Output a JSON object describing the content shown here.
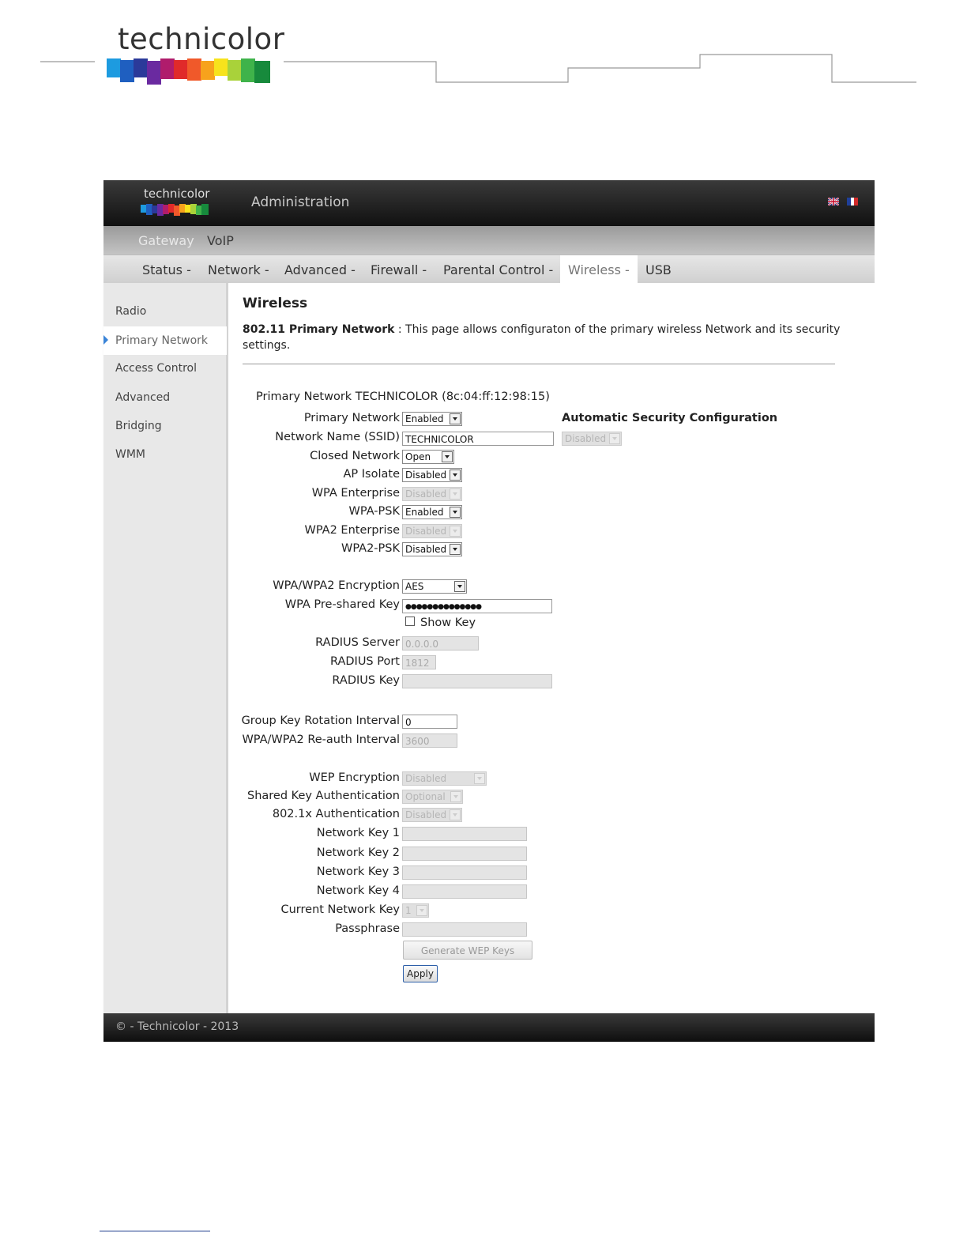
{
  "doc": {
    "logo_text": "technicolor"
  },
  "app": {
    "logo_text": "technicolor",
    "title": "Administration",
    "languages": [
      "english-flag-icon",
      "french-flag-icon"
    ]
  },
  "nav_primary": [
    "Gateway",
    "VoIP"
  ],
  "nav_secondary": {
    "status": "Status -",
    "network": "Network -",
    "advanced": "Advanced -",
    "firewall": "Firewall -",
    "parental": "Parental Control -",
    "wireless": "Wireless -",
    "usb": "USB",
    "active": "Wireless -"
  },
  "sidebar": {
    "items": [
      "Radio",
      "Primary Network",
      "Access Control",
      "Advanced",
      "Bridging",
      "WMM"
    ],
    "active": "Primary Network"
  },
  "page": {
    "title": "Wireless",
    "desc_bold": "802.11 Primary Network",
    "desc_text": " :  This page allows configuraton of the primary wireless Network and its security settings.",
    "network_header": "Primary Network TECHNICOLOR (8c:04:ff:12:98:15)"
  },
  "form": {
    "primary_network": {
      "label": "Primary Network",
      "value": "Enabled"
    },
    "ssid": {
      "label": "Network Name (SSID)",
      "value": "TECHNICOLOR"
    },
    "closed_network": {
      "label": "Closed Network",
      "value": "Open"
    },
    "ap_isolate": {
      "label": "AP Isolate",
      "value": "Disabled"
    },
    "wpa_enterprise": {
      "label": "WPA Enterprise",
      "value": "Disabled"
    },
    "wpa_psk": {
      "label": "WPA-PSK",
      "value": "Enabled"
    },
    "wpa2_enterprise": {
      "label": "WPA2 Enterprise",
      "value": "Disabled"
    },
    "wpa2_psk": {
      "label": "WPA2-PSK",
      "value": "Disabled"
    },
    "encryption": {
      "label": "WPA/WPA2 Encryption",
      "value": "AES"
    },
    "psk": {
      "label": "WPA Pre-shared Key",
      "value": "●●●●●●●●●●●●●●"
    },
    "show_key": "Show Key",
    "radius_server": {
      "label": "RADIUS Server",
      "value": "0.0.0.0"
    },
    "radius_port": {
      "label": "RADIUS Port",
      "value": "1812"
    },
    "radius_key": {
      "label": "RADIUS Key",
      "value": ""
    },
    "group_key": {
      "label": "Group Key Rotation Interval",
      "value": "0"
    },
    "reauth": {
      "label": "WPA/WPA2 Re-auth Interval",
      "value": "3600"
    },
    "wep_encryption": {
      "label": "WEP Encryption",
      "value": "Disabled"
    },
    "shared_key_auth": {
      "label": "Shared Key Authentication",
      "value": "Optional"
    },
    "auth_8021x": {
      "label": "802.1x Authentication",
      "value": "Disabled"
    },
    "key1": {
      "label": "Network Key 1",
      "value": ""
    },
    "key2": {
      "label": "Network Key 2",
      "value": ""
    },
    "key3": {
      "label": "Network Key 3",
      "value": ""
    },
    "key4": {
      "label": "Network Key 4",
      "value": ""
    },
    "current_key": {
      "label": "Current Network Key",
      "value": "1"
    },
    "passphrase": {
      "label": "Passphrase",
      "value": ""
    },
    "generate_button": "Generate WEP Keys",
    "apply_button": "Apply"
  },
  "auto_security": {
    "title": "Automatic Security Configuration",
    "value": "Disabled"
  },
  "footer": {
    "text": "© - Technicolor - 2013"
  },
  "colors": {
    "accent_arrow": "#3a84d8",
    "apply_border": "#2d5fa8"
  }
}
